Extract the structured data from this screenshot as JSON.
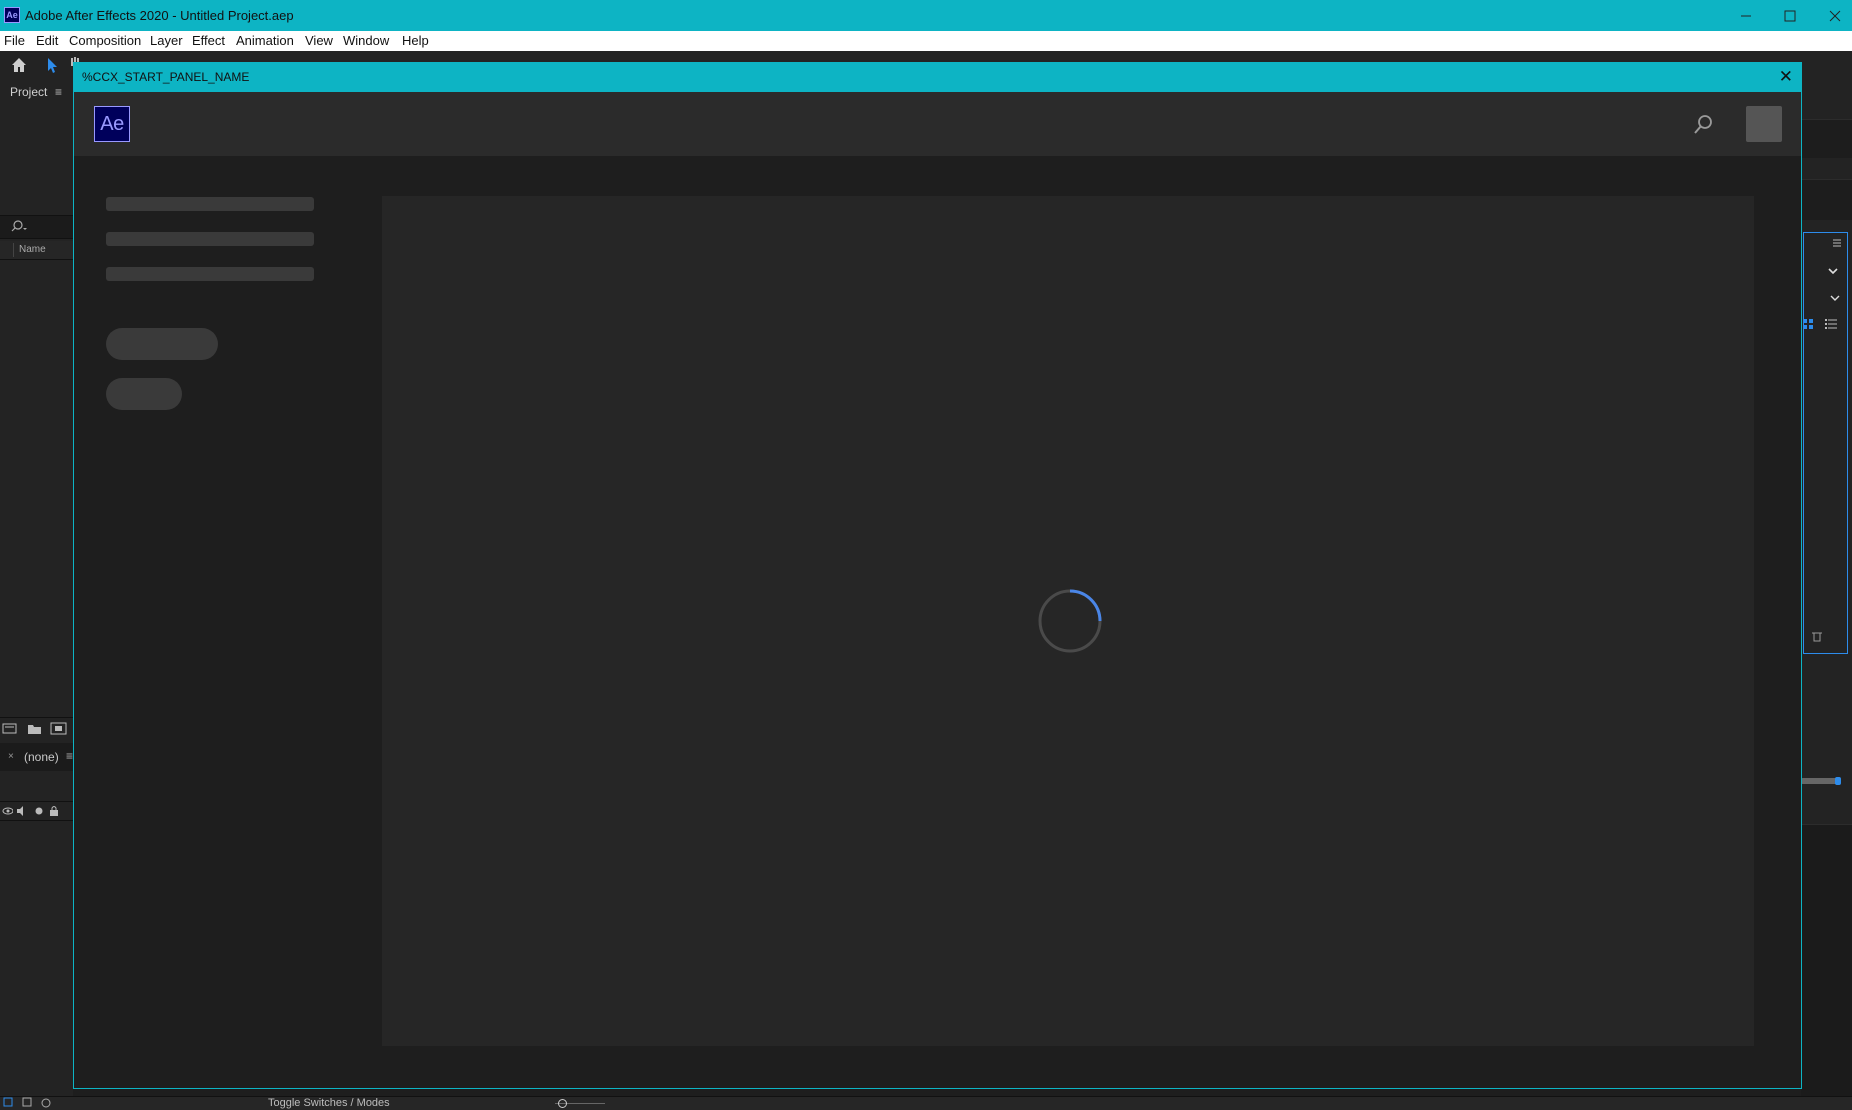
{
  "window": {
    "app_icon": "Ae",
    "title": "Adobe After Effects 2020 - Untitled Project.aep",
    "controls": [
      "minimize-icon",
      "maximize-icon",
      "close-icon"
    ]
  },
  "menu": {
    "items": [
      "File",
      "Edit",
      "Composition",
      "Layer",
      "Effect",
      "Animation",
      "View",
      "Window",
      "Help"
    ]
  },
  "project_panel": {
    "tab_label": "Project",
    "tab_menu": "≡",
    "search_icon": "search-icon",
    "column_name": "Name"
  },
  "timeline_panel": {
    "close": "×",
    "tab_label": "(none)",
    "tab_menu": "≡"
  },
  "statusbar": {
    "toggle_label": "Toggle Switches / Modes"
  },
  "start_dialog": {
    "title": "%CCX_START_PANEL_NAME",
    "close": "✕",
    "logo_text": "Ae",
    "state": "loading",
    "colors": {
      "title_bar": "#0db4c4",
      "logo_bg": "#00005b",
      "logo_text": "#9999ff",
      "spinner_accent": "#4a86e8"
    }
  }
}
